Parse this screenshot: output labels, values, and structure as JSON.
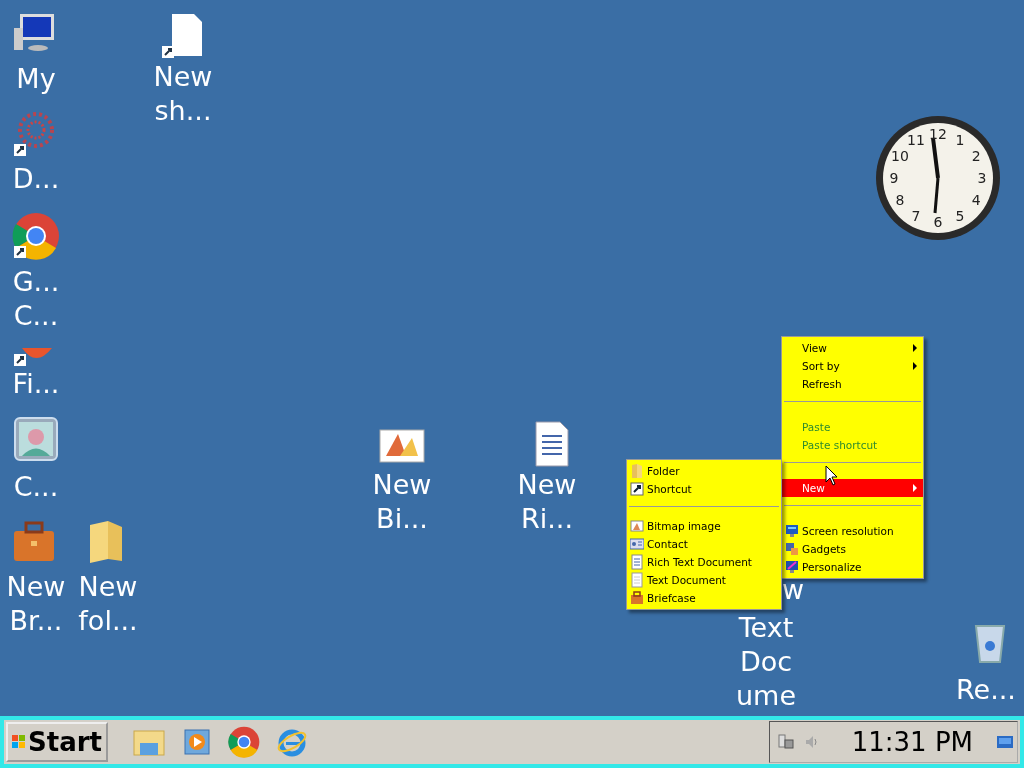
{
  "desktop_icons": [
    {
      "label": "My"
    },
    {
      "label": "D..."
    },
    {
      "label": "G... C..."
    },
    {
      "label": "Fi..."
    },
    {
      "label": "C..."
    },
    {
      "label": "New Br..."
    },
    {
      "label": "New fol..."
    },
    {
      "label": "New sh..."
    },
    {
      "label": "New Bi..."
    },
    {
      "label": "New Ri..."
    },
    {
      "cut_label": "w",
      "label": "Text Doc ume"
    },
    {
      "label": "Re..."
    }
  ],
  "clock_gadget": {
    "numerals": [
      "12",
      "11",
      "1",
      "10",
      "2",
      "9",
      "3",
      "8",
      "4",
      "7",
      "5",
      "6"
    ]
  },
  "context_menu": {
    "items": [
      {
        "kind": "item",
        "label": "View",
        "submenu": true,
        "disabled": false,
        "selected": false
      },
      {
        "kind": "item",
        "label": "Sort by",
        "submenu": true,
        "disabled": false,
        "selected": false
      },
      {
        "kind": "item",
        "label": "Refresh",
        "submenu": false,
        "disabled": false,
        "selected": false
      },
      {
        "kind": "separator"
      },
      {
        "kind": "item",
        "label": "Paste",
        "submenu": false,
        "disabled": true,
        "selected": false
      },
      {
        "kind": "item",
        "label": "Paste shortcut",
        "submenu": false,
        "disabled": true,
        "selected": false
      },
      {
        "kind": "separator"
      },
      {
        "kind": "item",
        "label": "New",
        "submenu": true,
        "disabled": false,
        "selected": true
      },
      {
        "kind": "separator"
      },
      {
        "kind": "item",
        "label": "Screen resolution",
        "submenu": false,
        "disabled": false,
        "selected": false
      },
      {
        "kind": "item",
        "label": "Gadgets",
        "submenu": false,
        "disabled": false,
        "selected": false
      },
      {
        "kind": "item",
        "label": "Personalize",
        "submenu": false,
        "disabled": false,
        "selected": false
      }
    ]
  },
  "submenu": {
    "items": [
      {
        "kind": "item",
        "label": "Folder"
      },
      {
        "kind": "item",
        "label": "Shortcut"
      },
      {
        "kind": "separator"
      },
      {
        "kind": "item",
        "label": "Bitmap image"
      },
      {
        "kind": "item",
        "label": "Contact"
      },
      {
        "kind": "item",
        "label": "Rich Text Document"
      },
      {
        "kind": "item",
        "label": "Text Document"
      },
      {
        "kind": "item",
        "label": "Briefcase"
      }
    ]
  },
  "taskbar": {
    "start_label": "Start",
    "time": "11:31 PM"
  }
}
